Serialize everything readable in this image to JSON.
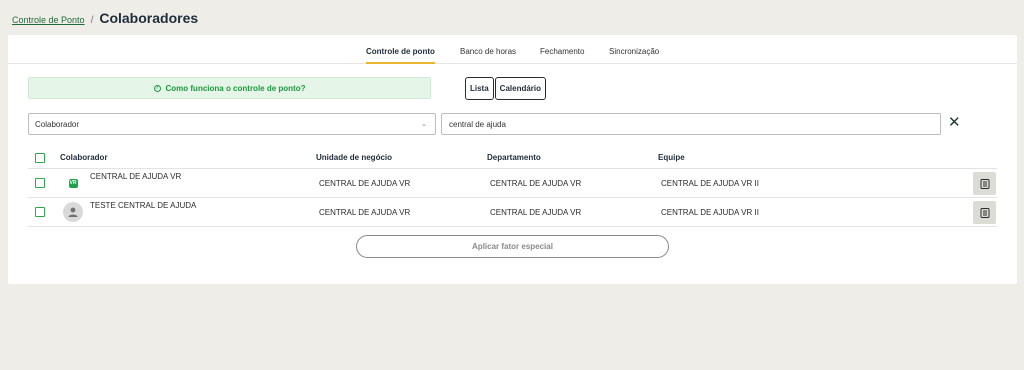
{
  "breadcrumb": {
    "parent": "Controle de Ponto",
    "separator": "/",
    "current": "Colaboradores"
  },
  "tabs": [
    {
      "label": "Controle de ponto",
      "active": true
    },
    {
      "label": "Banco de horas",
      "active": false
    },
    {
      "label": "Fechamento",
      "active": false
    },
    {
      "label": "Sincronização",
      "active": false
    }
  ],
  "help": {
    "label": "Como funciona o controle de ponto?",
    "icon": "question-circle-icon"
  },
  "view_toggle": {
    "list": "Lista",
    "calendar": "Calendário"
  },
  "filter": {
    "select_value": "Colaborador",
    "search_value": "central de ajuda"
  },
  "table": {
    "headers": {
      "name": "Colaborador",
      "unit": "Unidade de negócio",
      "dept": "Departamento",
      "team": "Equipe"
    },
    "rows": [
      {
        "name": "CENTRAL DE AJUDA VR",
        "unit": "CENTRAL DE AJUDA VR",
        "dept": "CENTRAL DE AJUDA VR",
        "team": "CENTRAL DE AJUDA VR II",
        "avatar": "vr-logo",
        "logo_text": "VR"
      },
      {
        "name": "TESTE CENTRAL DE AJUDA",
        "unit": "CENTRAL DE AJUDA VR",
        "dept": "CENTRAL DE AJUDA VR",
        "team": "CENTRAL DE AJUDA VR II",
        "avatar": "person-icon"
      }
    ]
  },
  "actions": {
    "apply_label": "Aplicar fator especial"
  },
  "colors": {
    "accent": "#e8b630",
    "success": "#1e9a3e",
    "checkbox": "#2fa84f",
    "background": "#efede8"
  }
}
